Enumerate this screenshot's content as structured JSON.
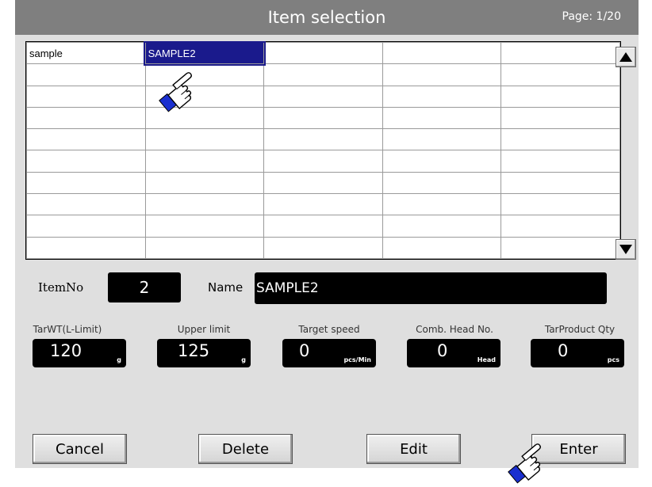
{
  "title": "Item selection",
  "page": "Page: 1/20",
  "grid": [
    [
      "sample",
      "SAMPLE2",
      "",
      "",
      ""
    ],
    [
      "",
      "",
      "",
      "",
      ""
    ],
    [
      "",
      "",
      "",
      "",
      ""
    ],
    [
      "",
      "",
      "",
      "",
      ""
    ],
    [
      "",
      "",
      "",
      "",
      ""
    ],
    [
      "",
      "",
      "",
      "",
      ""
    ],
    [
      "",
      "",
      "",
      "",
      ""
    ],
    [
      "",
      "",
      "",
      "",
      ""
    ],
    [
      "",
      "",
      "",
      "",
      ""
    ],
    [
      "",
      "",
      "",
      "",
      ""
    ]
  ],
  "selected_cell": {
    "row": 0,
    "col": 1
  },
  "item": {
    "itemno_label": "ItemNo",
    "itemno": "2",
    "name_label": "Name",
    "name": "SAMPLE2"
  },
  "fields": [
    {
      "label": "TarWT(L-Limit)",
      "value": "120",
      "unit": "g"
    },
    {
      "label": "Upper limit",
      "value": "125",
      "unit": "g"
    },
    {
      "label": "Target speed",
      "value": "0",
      "unit": "pcs/Min"
    },
    {
      "label": "Comb. Head No.",
      "value": "0",
      "unit": "Head"
    },
    {
      "label": "TarProduct Qty",
      "value": "0",
      "unit": "pcs"
    }
  ],
  "buttons": {
    "cancel": "Cancel",
    "delete": "Delete",
    "edit": "Edit",
    "enter": "Enter"
  },
  "icons": {
    "scroll_up": "triangle-up-icon",
    "scroll_down": "triangle-down-icon",
    "pointer": "pointing-hand-icon"
  },
  "colors": {
    "titlebar": "#7f7f7f",
    "selection": "#1a1a8c",
    "background": "#dfdfdf",
    "lcd": "#000000"
  }
}
